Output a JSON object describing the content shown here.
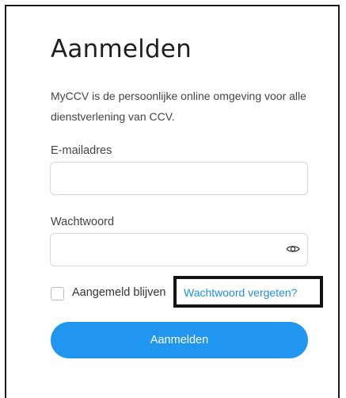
{
  "login": {
    "title": "Aanmelden",
    "description": "MyCCV is de persoonlijke online omgeving voor alle dienstverlening van CCV.",
    "email_label": "E-mailadres",
    "email_value": "",
    "password_label": "Wachtwoord",
    "password_value": "",
    "show_password_icon": "eye-icon",
    "remember_label": "Aangemeld blijven",
    "remember_checked": false,
    "forgot_link": "Wachtwoord vergeten?",
    "submit_label": "Aanmelden"
  },
  "colors": {
    "accent": "#2196f0",
    "link": "#1e8fe6",
    "highlight_border": "#141414",
    "input_border": "#d7d7d7"
  }
}
